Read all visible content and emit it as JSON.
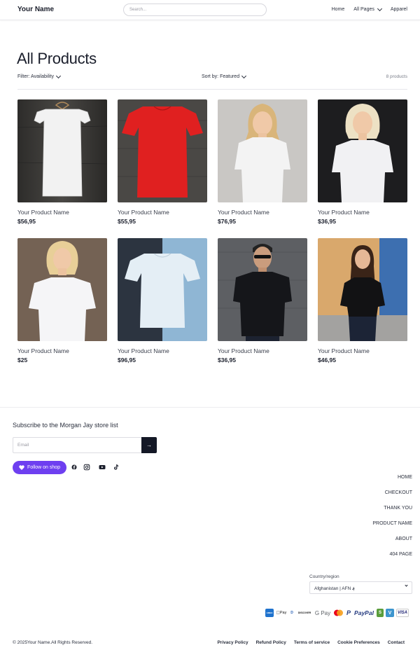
{
  "header": {
    "brand": "Your Name",
    "search_placeholder": "Search...",
    "nav": [
      "Home",
      "All Pages",
      "Apparel"
    ]
  },
  "collection": {
    "title": "All Products",
    "filter_label": "Filter: Availability",
    "sort_label": "Sort by: Featured",
    "count": "8 products"
  },
  "products": [
    {
      "name": "Your Product Name",
      "price": "$56,95",
      "image": "white-tshirt-on-hanger"
    },
    {
      "name": "Your Product Name",
      "price": "$55,95",
      "image": "red-tshirt-on-wood"
    },
    {
      "name": "Your Product Name",
      "price": "$76,95",
      "image": "woman-white-tshirt"
    },
    {
      "name": "Your Product Name",
      "price": "$36,95",
      "image": "woman-white-tshirt-dark"
    },
    {
      "name": "Your Product Name",
      "price": "$25",
      "image": "woman-white-tshirt-wall"
    },
    {
      "name": "Your Product Name",
      "price": "$96,95",
      "image": "white-tshirt-blue-bg"
    },
    {
      "name": "Your Product Name",
      "price": "$36,95",
      "image": "man-black-tshirt"
    },
    {
      "name": "Your Product Name",
      "price": "$46,95",
      "image": "woman-black-tshirt-street"
    }
  ],
  "footer": {
    "subscribe_title": "Subscribe to the Morgan Jay store list",
    "email_placeholder": "Email",
    "email_button": "→",
    "follow_label": "Follow on shop",
    "social": [
      "facebook-icon",
      "instagram-icon",
      "youtube-icon",
      "tiktok-icon"
    ],
    "links": [
      "HOME",
      "CHECKOUT",
      "THANK YOU",
      "PRODUCT NAME",
      "ABOUT",
      "404 PAGE"
    ],
    "country_label": "Country/region",
    "country_value": "Afghanistan | AFN ؋",
    "payments": [
      "AMEX",
      "Pay",
      "D",
      "DISCOVER",
      "G Pay",
      "MC",
      "P",
      "PayPal",
      "S",
      "V",
      "VISA"
    ],
    "copyright": "© 2025Your Name.All Rights Reserved.",
    "legal": [
      "Privacy Policy",
      "Refund Policy",
      "Terms of service",
      "Cookie Preferences",
      "Contact"
    ]
  },
  "colors": {
    "accent": "#6e3ff0",
    "dark": "#141826",
    "text": "#1f2433"
  }
}
